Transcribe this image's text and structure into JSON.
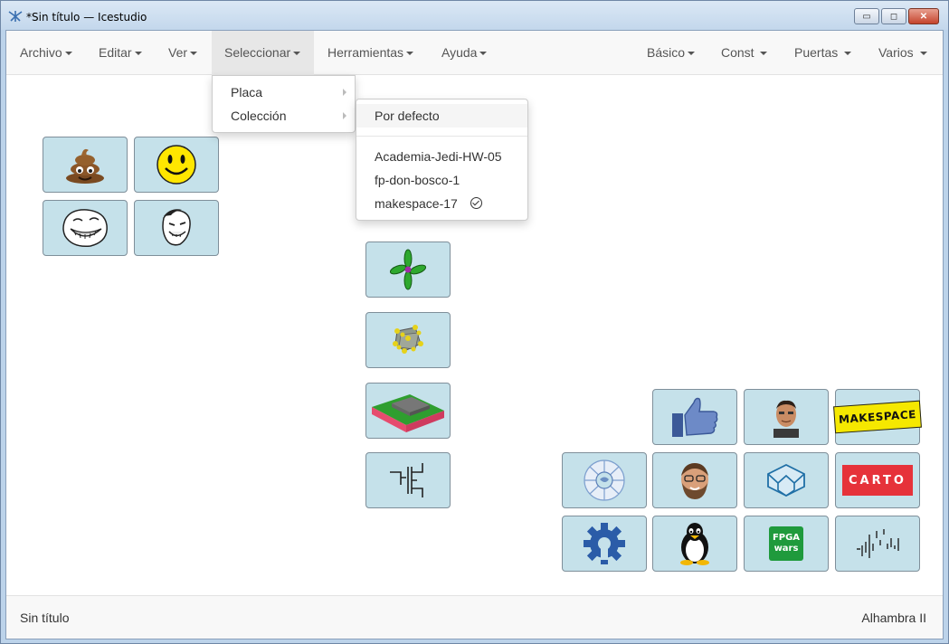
{
  "window": {
    "title": "*Sin título — Icestudio",
    "controls": {
      "minimize": "▭",
      "maximize": "◻",
      "close": "✕"
    }
  },
  "menubar": {
    "left": [
      {
        "label": "Archivo"
      },
      {
        "label": "Editar"
      },
      {
        "label": "Ver"
      },
      {
        "label": "Seleccionar"
      },
      {
        "label": "Herramientas"
      },
      {
        "label": "Ayuda"
      }
    ],
    "right": [
      {
        "label": "Básico"
      },
      {
        "label": "Const"
      },
      {
        "label": "Puertas"
      },
      {
        "label": "Varios"
      }
    ],
    "active": "Seleccionar"
  },
  "select_menu": {
    "items": [
      {
        "label": "Placa"
      },
      {
        "label": "Colección"
      }
    ]
  },
  "collection_submenu": {
    "default_label": "Por defecto",
    "items": [
      {
        "label": "Academia-Jedi-HW-05"
      },
      {
        "label": "fp-don-bosco-1"
      },
      {
        "label": "makespace-17",
        "checked": true
      }
    ]
  },
  "tiles": {
    "left_group": [
      "poop-emoji",
      "smiley-face",
      "trollface",
      "yao-ming-meme"
    ],
    "center_column": [
      "clover-logo",
      "molecule",
      "pcb-board",
      "circuit-symbol"
    ],
    "right_group_row1": [
      "thumbs-up",
      "person-portrait",
      "makespace-logo"
    ],
    "right_group_row2": [
      "puzzle-circle",
      "bearded-portrait",
      "geometric-shape",
      "carto-logo"
    ],
    "right_group_row3": [
      "gear-logo",
      "tux-penguin",
      "fpga-wars-logo",
      "waveform"
    ]
  },
  "tile_text": {
    "makespace": "MAKESPACE",
    "carto": "CARTO",
    "fpga_top": "FPGA",
    "fpga_bottom": "wars"
  },
  "footer": {
    "left": "Sin título",
    "right": "Alhambra II"
  },
  "colors": {
    "tile_bg": "#c5e1ea",
    "tile_border": "#7f8f9a",
    "navbar_bg": "#f8f8f8",
    "active_menu_bg": "#e7e7e7",
    "makespace_yellow": "#f5e800",
    "carto_red": "#e6323a"
  }
}
